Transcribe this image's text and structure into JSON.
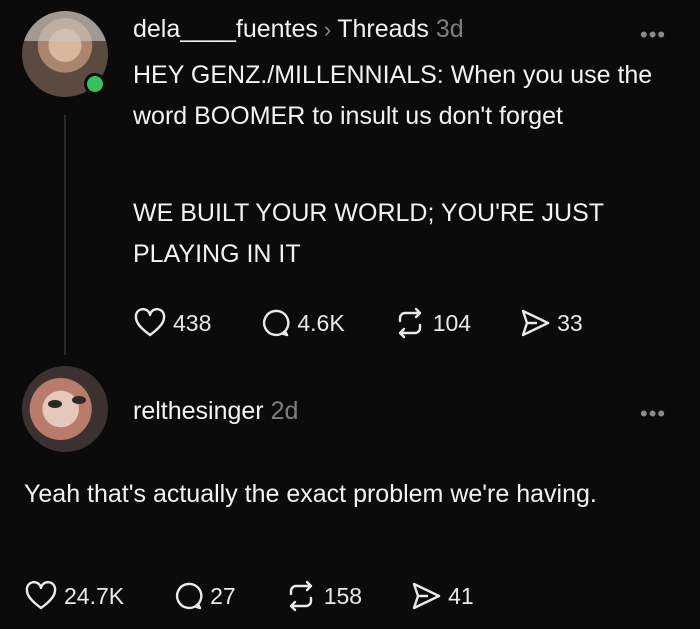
{
  "post1": {
    "username": "dela____fuentes",
    "separator": "›",
    "platform": "Threads",
    "age": "3d",
    "more_label": "•••",
    "paragraph1": "HEY GENZ./MILLENNIALS: When you use the word BOOMER to insult us don't forget",
    "paragraph2": "WE BUILT YOUR WORLD; YOU'RE JUST PLAYING IN IT",
    "likes": "438",
    "comments": "4.6K",
    "reposts": "104",
    "shares": "33"
  },
  "post2": {
    "username": "relthesinger",
    "age": "2d",
    "more_label": "•••",
    "text": "Yeah that's actually the exact problem we're having.",
    "likes": "24.7K",
    "comments": "27",
    "reposts": "158",
    "shares": "41"
  },
  "colors": {
    "online": "#36c15b",
    "background": "#0b0b0b",
    "muted": "#7f7f7f"
  },
  "icons": [
    "heart-icon",
    "comment-icon",
    "repost-icon",
    "share-icon",
    "more-icon"
  ]
}
